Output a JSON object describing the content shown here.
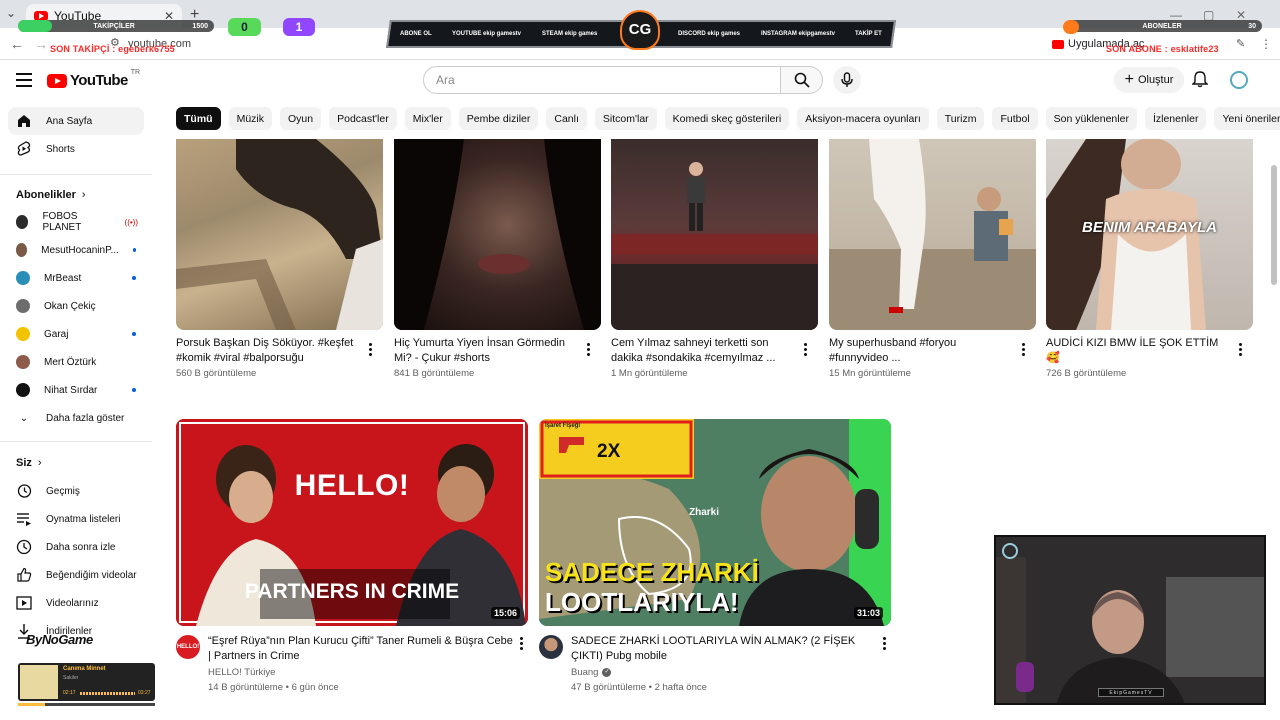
{
  "browser": {
    "tab_title": "YouTube",
    "url": "youtube.com",
    "ext_app_label": "Uygulamada aç"
  },
  "overlay": {
    "followers_label": "TAKİPÇİLER",
    "followers_current": "290",
    "followers_goal": "1500",
    "subscribers_label": "ABONELER",
    "subscribers_current": "0",
    "subscribers_goal": "30",
    "kick_count": "0",
    "twitch_count": "1",
    "last_follower": "SON TAKİPÇİ : egeberk6755",
    "last_subscriber": "SON ABONE : esklatife23",
    "banner_items": [
      "ABONE OL",
      "YOUTUBE ekip gamestv",
      "STEAM ekip games",
      "DISCORD ekip games",
      "INSTAGRAM ekipgamestv",
      "TAKİP ET"
    ],
    "logo_text": "CG",
    "webcam_tag": "EkipGamesTV",
    "sponsor": "ByNoGame",
    "music_title": "Canıma Minnet",
    "music_artist": "Sakiler",
    "music_elapsed": "02:17",
    "music_total": "03:27"
  },
  "header": {
    "logo_text": "YouTube",
    "logo_region": "TR",
    "search_placeholder": "Ara",
    "create_label": "Oluştur"
  },
  "chips": [
    "Tümü",
    "Müzik",
    "Oyun",
    "Podcast'ler",
    "Mix'ler",
    "Pembe diziler",
    "Canlı",
    "Sitcom'lar",
    "Komedi skeç gösterileri",
    "Aksiyon-macera oyunları",
    "Turizm",
    "Futbol",
    "Son yüklenenler",
    "İzlenenler",
    "Yeni öneriler"
  ],
  "sidebar": {
    "home": "Ana Sayfa",
    "shorts": "Shorts",
    "subscriptions_heading": "Abonelikler",
    "channels": [
      {
        "name": "FOBOS PLANET",
        "color": "#2b2b2b"
      },
      {
        "name": "MesutHocaninP...",
        "color": "#7a5a46"
      },
      {
        "name": "MrBeast",
        "color": "#2a8fb8"
      },
      {
        "name": "Okan Çekiç",
        "color": "#6d6d6d"
      },
      {
        "name": "Garaj",
        "color": "#f2c400"
      },
      {
        "name": "Mert Öztürk",
        "color": "#8e5a4a"
      },
      {
        "name": "Nihat Sırdar",
        "color": "#111111"
      }
    ],
    "show_more": "Daha fazla göster",
    "you_heading": "Siz",
    "you_items": [
      "Geçmiş",
      "Oynatma listeleri",
      "Daha sonra izle",
      "Beğendiğim videolar",
      "Videolarınız",
      "İndirilenler"
    ]
  },
  "videos_row1": [
    {
      "title": "Porsuk Başkan Diş Söküyor. #keşfet #komik #viral #balporsuğu",
      "views": "560 B görüntüleme"
    },
    {
      "title": "Hiç Yumurta Yiyen İnsan Görmedin Mi? - Çukur #shorts",
      "views": "841 B görüntüleme"
    },
    {
      "title": "Cem Yılmaz sahneyi terketti son dakika #sondakika #cemyılmaz ...",
      "views": "1 Mn görüntüleme"
    },
    {
      "title": "My superhusband #foryou #funnyvideo ...",
      "views": "15 Mn görüntüleme"
    },
    {
      "title": "AUDİCİ KIZI BMW İLE ŞOK ETTİM 🥰",
      "views": "726 B görüntüleme",
      "overlay_text": "BENIM ARABAYLA"
    }
  ],
  "videos_row2": [
    {
      "title": "“Eşref Rüya”nın Plan Kurucu Çifti” Taner Rumeli & Büşra Cebe | Partners in Crime",
      "channel": "HELLO! Türkiye",
      "meta": "14 B görüntüleme • 6 gün önce",
      "duration": "15:06",
      "thumb_text1": "HELLO!",
      "thumb_text2": "PARTNERS IN CRIME",
      "avatar_text": "HELLO!"
    },
    {
      "title": "SADECE ZHARKİ LOOTLARIYLA WİN ALMAK? (2 FİŞEK ÇIKTI) Pubg mobile",
      "channel": "Buang",
      "meta": "47 B görüntüleme • 2 hafta önce",
      "duration": "31:03",
      "thumb_text1": "SADECE ZHARKİ",
      "thumb_text2": "LOOTLARIYLA!",
      "thumb_badge": "2X",
      "thumb_flare": "İşaret Fişeği",
      "thumb_map": "Zharki"
    }
  ]
}
